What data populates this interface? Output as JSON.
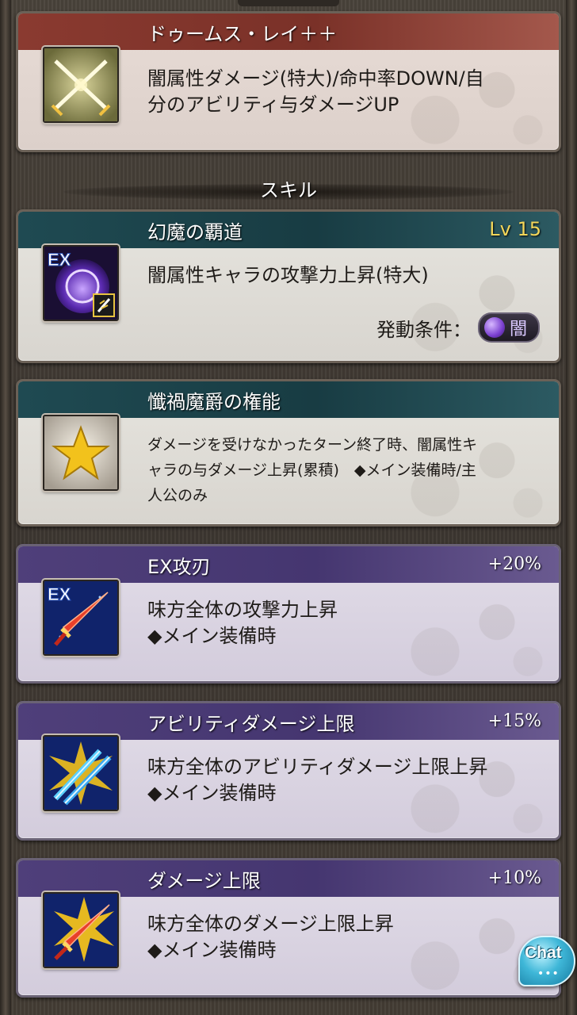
{
  "ability": {
    "title": "ドゥームス・レイ＋＋",
    "icon": "crossed-swords-icon",
    "desc_lines": [
      "闇属性ダメージ(特大)/命中率DOWN/自",
      "分のアビリティ与ダメージUP"
    ]
  },
  "section": {
    "label": "スキル"
  },
  "skills": [
    {
      "title": "幻魔の覇道",
      "level": "Lv 15",
      "icon": "ex-dark-emblem-icon",
      "desc_lines": [
        "闇属性キャラの攻撃力上昇(特大)"
      ],
      "condition_label": "発動条件：",
      "condition_value": "闇"
    },
    {
      "title": "懺禍魔爵の権能",
      "icon": "gold-star-icon",
      "desc_lines": [
        "ダメージを受けなかったターン終了時、闇属性キ",
        "ャラの与ダメージ上昇(累積)　◆メイン装備時/主",
        "人公のみ"
      ]
    }
  ],
  "weapon_skills": [
    {
      "title": "EX攻刃",
      "value": "+20%",
      "icon": "ex-red-sword-icon",
      "desc_lines": [
        "味方全体の攻撃力上昇",
        "◆メイン装備時"
      ]
    },
    {
      "title": "アビリティダメージ上限",
      "value": "+15%",
      "icon": "blue-blades-burst-icon",
      "desc_lines": [
        "味方全体のアビリティダメージ上限上昇",
        "◆メイン装備時"
      ]
    },
    {
      "title": "ダメージ上限",
      "value": "+10%",
      "icon": "red-sword-burst-icon",
      "desc_lines": [
        "味方全体のダメージ上限上昇",
        "◆メイン装備時"
      ]
    }
  ],
  "chat": {
    "label": "Chat",
    "dots": "•••"
  }
}
